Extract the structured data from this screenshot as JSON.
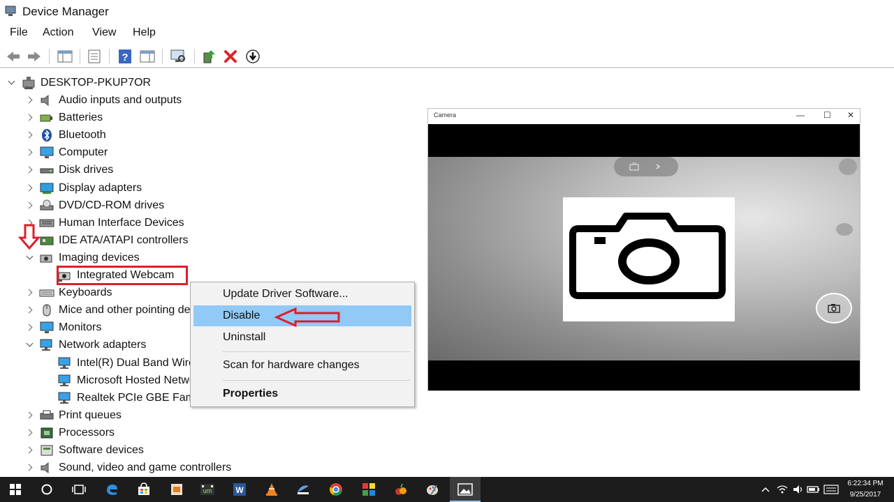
{
  "window": {
    "title": "Device Manager"
  },
  "menu": {
    "file": "File",
    "action": "Action",
    "view": "View",
    "help": "Help"
  },
  "tree": {
    "root": "DESKTOP-PKUP7OR",
    "items": [
      {
        "label": "Audio inputs and outputs",
        "icon": "speaker-icon",
        "state": "collapsed"
      },
      {
        "label": "Batteries",
        "icon": "battery-icon",
        "state": "collapsed"
      },
      {
        "label": "Bluetooth",
        "icon": "bluetooth-icon",
        "state": "collapsed"
      },
      {
        "label": "Computer",
        "icon": "computer-icon",
        "state": "collapsed"
      },
      {
        "label": "Disk drives",
        "icon": "disk-drive-icon",
        "state": "collapsed"
      },
      {
        "label": "Display adapters",
        "icon": "display-adapter-icon",
        "state": "collapsed"
      },
      {
        "label": "DVD/CD-ROM drives",
        "icon": "dvd-drive-icon",
        "state": "collapsed"
      },
      {
        "label": "Human Interface Devices",
        "icon": "hid-icon",
        "state": "collapsed"
      },
      {
        "label": "IDE ATA/ATAPI controllers",
        "icon": "ide-controller-icon",
        "state": "collapsed"
      },
      {
        "label": "Imaging devices",
        "icon": "camera-icon",
        "state": "expanded"
      },
      {
        "label": "Integrated Webcam",
        "icon": "webcam-icon",
        "state": "child"
      },
      {
        "label": "Keyboards",
        "icon": "keyboard-icon",
        "state": "collapsed"
      },
      {
        "label": "Mice and other pointing devices",
        "icon": "mouse-icon",
        "state": "collapsed"
      },
      {
        "label": "Monitors",
        "icon": "monitor-icon",
        "state": "collapsed"
      },
      {
        "label": "Network adapters",
        "icon": "network-icon",
        "state": "expanded"
      },
      {
        "label": "Intel(R) Dual Band Wireless",
        "icon": "network-icon",
        "state": "child"
      },
      {
        "label": "Microsoft Hosted Network",
        "icon": "network-icon",
        "state": "child"
      },
      {
        "label": "Realtek PCIe GBE Family",
        "icon": "network-icon",
        "state": "child"
      },
      {
        "label": "Print queues",
        "icon": "printer-icon",
        "state": "collapsed"
      },
      {
        "label": "Processors",
        "icon": "processor-icon",
        "state": "collapsed"
      },
      {
        "label": "Software devices",
        "icon": "software-device-icon",
        "state": "collapsed"
      },
      {
        "label": "Sound, video and game controllers",
        "icon": "speaker-icon",
        "state": "collapsed"
      }
    ]
  },
  "context_menu": {
    "update": "Update Driver Software...",
    "disable": "Disable",
    "uninstall": "Uninstall",
    "scan": "Scan for hardware changes",
    "properties": "Properties"
  },
  "camera_window": {
    "title": "Camera",
    "minimize": "—",
    "maximize": "☐",
    "close": "✕"
  },
  "taskbar": {
    "time": "6:22:34 PM",
    "date": "9/25/2017"
  },
  "colors": {
    "annotation_red": "#d9202b",
    "menu_highlight": "#91c9f7",
    "taskbar": "#1c1c1c"
  }
}
